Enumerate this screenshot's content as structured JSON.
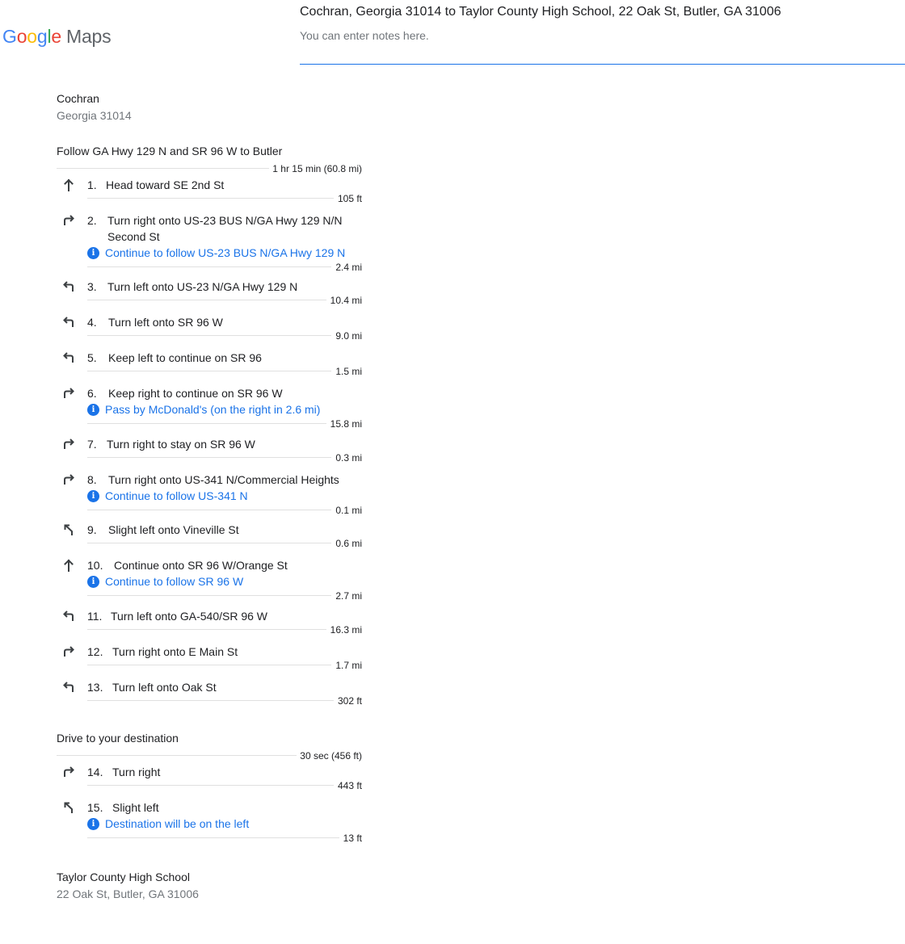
{
  "header": {
    "logo_letters": [
      "G",
      "o",
      "o",
      "g",
      "l",
      "e"
    ],
    "logo_suffix": "Maps",
    "route_title": "Cochran, Georgia 31014 to Taylor County High School, 22 Oak St, Butler, GA 31006",
    "notes_placeholder": "You can enter notes here."
  },
  "origin": {
    "name": "Cochran",
    "address": "Georgia 31014"
  },
  "sections": [
    {
      "heading": "Follow GA Hwy 129 N and SR 96 W to Butler",
      "summary": "1 hr 15 min (60.8 mi)",
      "steps": [
        {
          "num": "1.",
          "icon": "straight-arrow-icon",
          "text": "Head toward SE 2nd St",
          "note": "",
          "dist": "105 ft"
        },
        {
          "num": "2.",
          "icon": "turn-right-icon",
          "text": "Turn right onto US-23 BUS N/GA Hwy 129 N/N Second St",
          "note": "Continue to follow US-23 BUS N/GA Hwy 129 N",
          "dist": "2.4 mi"
        },
        {
          "num": "3.",
          "icon": "turn-left-icon",
          "text": "Turn left onto US-23 N/GA Hwy 129 N",
          "note": "",
          "dist": "10.4 mi"
        },
        {
          "num": "4.",
          "icon": "turn-left-icon",
          "text": "Turn left onto SR 96 W",
          "note": "",
          "dist": "9.0 mi"
        },
        {
          "num": "5.",
          "icon": "turn-left-icon",
          "text": "Keep left to continue on SR 96",
          "note": "",
          "dist": "1.5 mi"
        },
        {
          "num": "6.",
          "icon": "turn-right-icon",
          "text": "Keep right to continue on SR 96 W",
          "note": "Pass by McDonald's (on the right in 2.6 mi)",
          "dist": "15.8 mi"
        },
        {
          "num": "7.",
          "icon": "turn-right-icon",
          "text": "Turn right to stay on SR 96 W",
          "note": "",
          "dist": "0.3 mi"
        },
        {
          "num": "8.",
          "icon": "turn-right-icon",
          "text": "Turn right onto US-341 N/Commercial Heights",
          "note": "Continue to follow US-341 N",
          "dist": "0.1 mi"
        },
        {
          "num": "9.",
          "icon": "slight-left-icon",
          "text": "Slight left onto Vineville St",
          "note": "",
          "dist": "0.6 mi"
        },
        {
          "num": "10.",
          "icon": "straight-arrow-icon",
          "text": "Continue onto SR 96 W/Orange St",
          "note": "Continue to follow SR 96 W",
          "dist": "2.7 mi"
        },
        {
          "num": "11.",
          "icon": "turn-left-icon",
          "text": "Turn left onto GA-540/SR 96 W",
          "note": "",
          "dist": "16.3 mi"
        },
        {
          "num": "12.",
          "icon": "turn-right-icon",
          "text": "Turn right onto E Main St",
          "note": "",
          "dist": "1.7 mi"
        },
        {
          "num": "13.",
          "icon": "turn-left-icon",
          "text": "Turn left onto Oak St",
          "note": "",
          "dist": "302 ft"
        }
      ]
    },
    {
      "heading": "Drive to your destination",
      "summary": "30 sec (456 ft)",
      "steps": [
        {
          "num": "14.",
          "icon": "turn-right-icon",
          "text": "Turn right",
          "note": "",
          "dist": "443 ft"
        },
        {
          "num": "15.",
          "icon": "slight-left-icon",
          "text": "Slight left",
          "note": "Destination will be on the left",
          "dist": "13 ft"
        }
      ]
    }
  ],
  "destination": {
    "name": "Taylor County High School",
    "address": "22 Oak St, Butler, GA 31006"
  },
  "colors": {
    "link": "#1a73e8",
    "rule": "#e0e0e0",
    "muted": "#70757a",
    "icon": "#3c4043"
  },
  "info_glyph": "i"
}
